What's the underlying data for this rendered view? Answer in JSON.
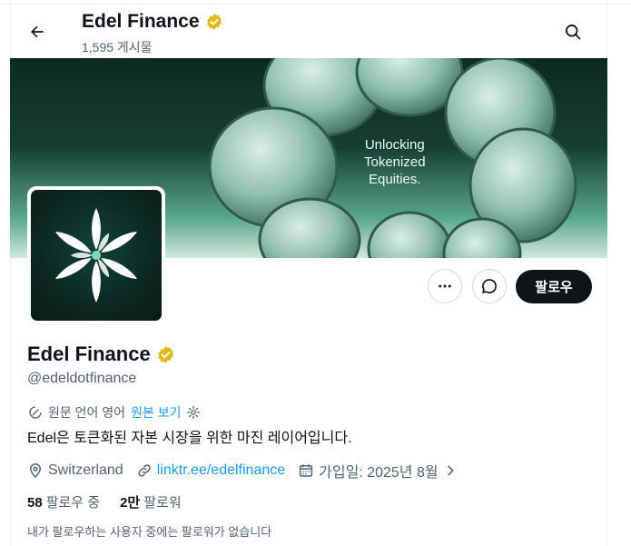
{
  "header": {
    "title": "Edel Finance",
    "post_count": "1,595 게시물"
  },
  "banner": {
    "tagline_lines": [
      "Unlocking",
      "Tokenized",
      "Equities."
    ]
  },
  "actions": {
    "follow_label": "팔로우"
  },
  "profile": {
    "name": "Edel Finance",
    "handle": "@edeldotfinance",
    "translation_notice": "원문 언어 영어",
    "translation_link": "원본 보기",
    "bio": "Edel은 토큰화된 자본 시장을 위한 마진 레이어입니다.",
    "location": "Switzerland",
    "website": "linktr.ee/edelfinance",
    "joined": "가입일: 2025년 8월",
    "following_count": "58",
    "following_label": "팔로우 중",
    "followers_count": "2만",
    "followers_label": "팔로워",
    "mutual_note": "내가 팔로우하는 사용자 중에는 팔로워가 없습니다"
  },
  "colors": {
    "accent": "#1d9bf0",
    "verified_badge": "#e2b719",
    "follow_button": "#0f1419",
    "secondary_text": "#536471"
  },
  "icons": [
    "back-arrow-icon",
    "search-icon",
    "verified-badge-icon",
    "more-icon",
    "message-icon",
    "translate-icon",
    "settings-icon",
    "location-icon",
    "link-icon",
    "calendar-icon",
    "chevron-right-icon"
  ]
}
